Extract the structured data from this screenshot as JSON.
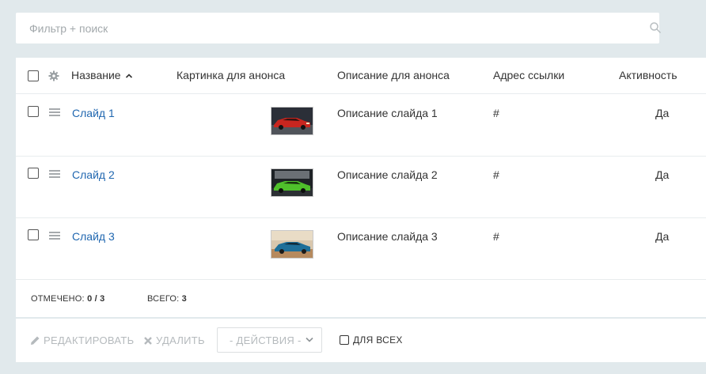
{
  "search": {
    "placeholder": "Фильтр + поиск",
    "value": ""
  },
  "columns": {
    "name": "Название",
    "image": "Картинка для анонса",
    "description": "Описание для анонса",
    "link": "Адрес ссылки",
    "active": "Активность"
  },
  "rows": [
    {
      "name": "Слайд 1",
      "description": "Описание слайда 1",
      "link": "#",
      "active": "Да",
      "image_icon": "red-car-thumbnail"
    },
    {
      "name": "Слайд 2",
      "description": "Описание слайда 2",
      "link": "#",
      "active": "Да",
      "image_icon": "green-car-thumbnail"
    },
    {
      "name": "Слайд 3",
      "description": "Описание слайда 3",
      "link": "#",
      "active": "Да",
      "image_icon": "blue-car-thumbnail"
    }
  ],
  "footer": {
    "selected_label": "ОТМЕЧЕНО:",
    "selected_value": "0 / 3",
    "total_label": "ВСЕГО:",
    "total_value": "3"
  },
  "actions": {
    "edit": "РЕДАКТИРОВАТЬ",
    "delete": "УДАЛИТЬ",
    "select_value": "- ДЕЙСТВИЯ -",
    "for_all": "ДЛЯ ВСЕХ"
  },
  "colors": {
    "background": "#e1e9ec",
    "link": "#2067b0",
    "disabled": "#b5babd"
  }
}
